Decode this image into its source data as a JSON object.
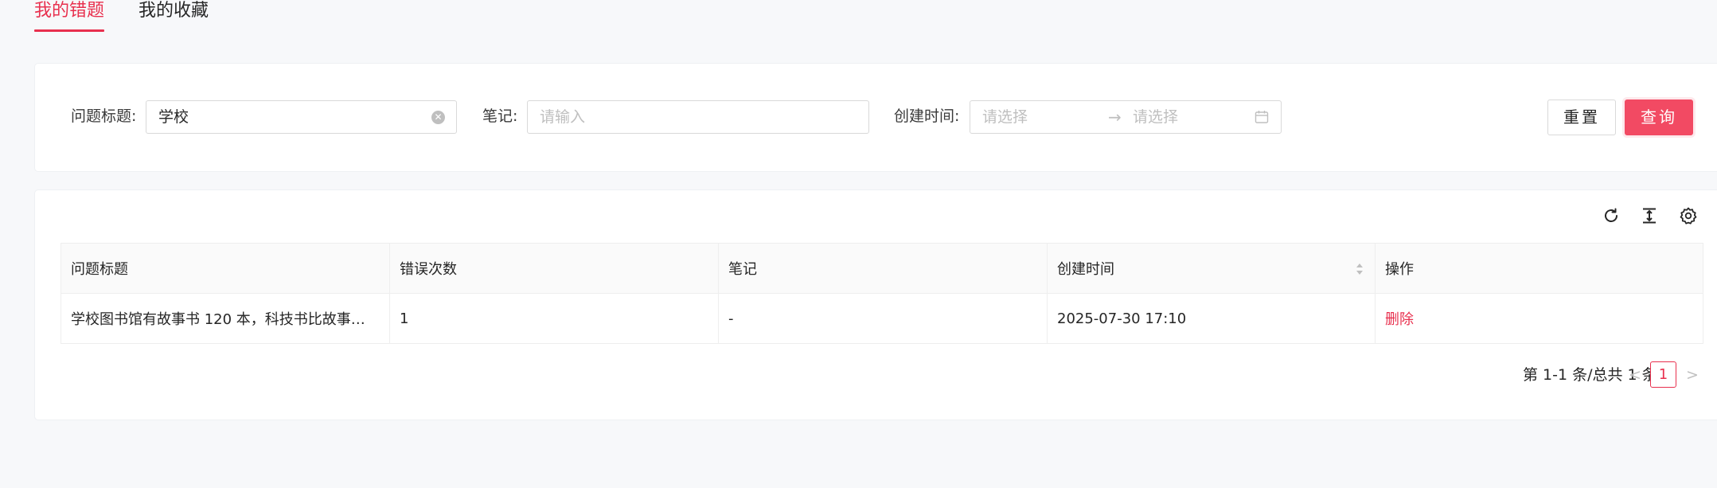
{
  "tabs": [
    {
      "label": "我的错题",
      "active": true
    },
    {
      "label": "我的收藏",
      "active": false
    }
  ],
  "filters": {
    "title_label": "问题标题:",
    "title_value": "学校",
    "note_label": "笔记:",
    "note_placeholder": "请输入",
    "created_label": "创建时间:",
    "start_placeholder": "请选择",
    "range_separator": "→",
    "end_placeholder": "请选择",
    "reset_label": "重置",
    "query_label": "查询"
  },
  "table": {
    "columns": [
      "问题标题",
      "错误次数",
      "笔记",
      "创建时间",
      "操作"
    ],
    "rows": [
      {
        "title": "学校图书馆有故事书 120 本，科技书比故事…",
        "errors": "1",
        "note": "-",
        "created": "2025-07-30 17:10",
        "action": "删除"
      }
    ]
  },
  "pagination": {
    "total_text": "第 1-1 条/总共 1 条",
    "current_page": "1",
    "prev": "<",
    "next": ">"
  },
  "colors": {
    "accent": "#e8304e",
    "button_primary": "#f24a63",
    "background": "#f7f8fa"
  }
}
